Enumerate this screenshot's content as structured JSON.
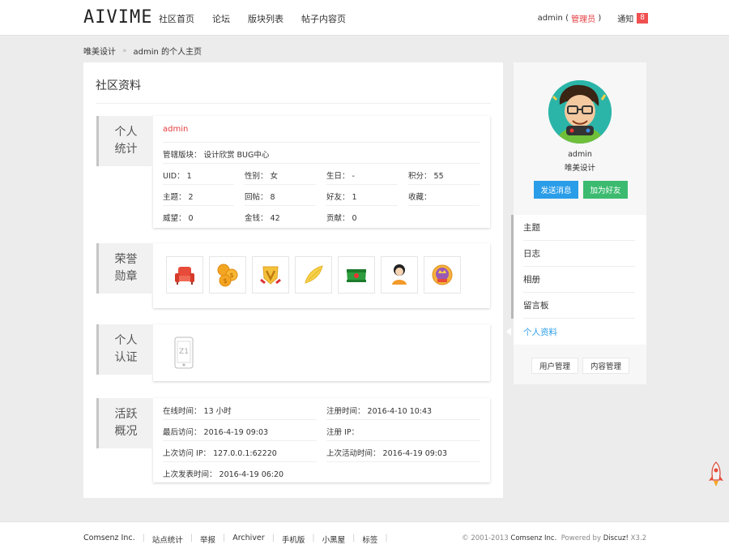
{
  "header": {
    "logo": "AIVIME",
    "nav": [
      "社区首页",
      "论坛",
      "版块列表",
      "帖子内容页"
    ],
    "user": "admin",
    "role_open": " ( ",
    "role": "管理员",
    "role_close": " )",
    "notice_label": "通知",
    "notice_count": "8"
  },
  "breadcrumb": {
    "home": "唯美设计",
    "sep": "»",
    "current": "admin 的个人主页"
  },
  "main": {
    "title": "社区资料",
    "stats": {
      "label_line1": "个人",
      "label_line2": "统计",
      "username": "admin",
      "moderated": "管辖版块：  设计欣赏  BUG中心",
      "fields": [
        [
          "UID：  1",
          "性别：  女",
          "生日：  -",
          "积分：  55"
        ],
        [
          "主题：  2",
          "回帖：  8",
          "好友：  1",
          "收藏："
        ],
        [
          "威望：  0",
          "金钱：  42",
          "贡献：  0",
          ""
        ]
      ]
    },
    "medals": {
      "label_line1": "荣誉",
      "label_line2": "勋章",
      "items": [
        "sofa-medal-icon",
        "coins-medal-icon",
        "v-shield-medal-icon",
        "wing-medal-icon",
        "green-cap-medal-icon",
        "girl-medal-icon",
        "crown-badge-medal-icon"
      ]
    },
    "verify": {
      "label_line1": "个人",
      "label_line2": "认证",
      "phone_text": "Z1"
    },
    "activity": {
      "label_line1": "活跃",
      "label_line2": "概况",
      "online_time": "在线时间：  13 小时",
      "reg_time": "注册时间：  2016-4-10 10:43",
      "last_visit": "最后访问：  2016-4-19 09:03",
      "reg_ip": "注册 IP：",
      "last_ip": "上次访问 IP：  127.0.0.1:62220",
      "last_active": "上次活动时间：  2016-4-19 09:03",
      "last_post": "上次发表时间：  2016-4-19 06:20"
    }
  },
  "side": {
    "name": "admin",
    "group": "唯美设计",
    "send_msg": "发送消息",
    "add_friend": "加为好友",
    "menu": [
      "主题",
      "日志",
      "相册",
      "留言板",
      "个人资料"
    ],
    "manage_user": "用户管理",
    "manage_content": "内容管理"
  },
  "footer": {
    "links": [
      "Comsenz Inc.",
      "站点统计",
      "举报",
      "Archiver",
      "手机版",
      "小黑屋",
      "标签"
    ],
    "copy_prefix": "© 2001-2013 ",
    "copy_company": "Comsenz Inc.",
    "copy_mid": "  Powered by ",
    "copy_product": "Discuz!",
    "copy_version": " X3.2"
  },
  "colors": {
    "accent_red": "#e4393c",
    "accent_blue": "#2a9de9",
    "accent_green": "#3cbb70"
  }
}
